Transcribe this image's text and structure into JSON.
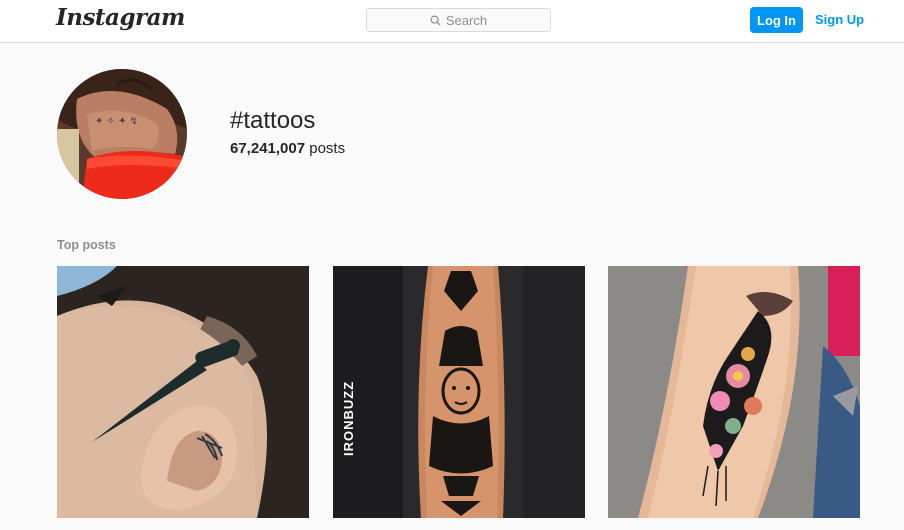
{
  "header": {
    "logo": "Instagram",
    "search_placeholder": "Search",
    "login_label": "Log In",
    "signup_label": "Sign Up",
    "accent_color": "#0095f6"
  },
  "hashtag": {
    "title": "#tattoos",
    "post_count": "67,241,007",
    "post_count_suffix": " posts"
  },
  "sections": {
    "top_posts_label": "Top posts"
  },
  "top_posts": [
    {
      "icon": "dagger-and-web-tattoo-photo"
    },
    {
      "icon": "blackwork-forearm-tattoo-photo",
      "watermark": "IRONBUZZ"
    },
    {
      "icon": "floral-woman-forearm-tattoo-photo"
    }
  ]
}
